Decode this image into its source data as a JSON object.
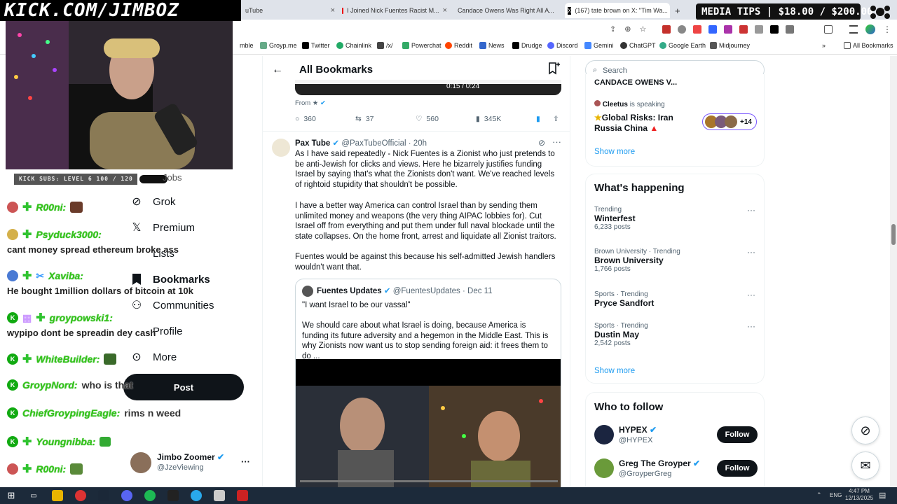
{
  "browser": {
    "tabs": [
      {
        "label": "uTube"
      },
      {
        "label": "I Joined Nick Fuentes Racist M..."
      },
      {
        "label": "Candace Owens Was Right All A..."
      },
      {
        "label": "(167) tate brown on X: \"Tim Wa..."
      }
    ],
    "new_tab": "+",
    "bookmarks": [
      "mble",
      "Groyp.me",
      "Twitter",
      "Chainlink",
      "/x/",
      "Powerchat",
      "Reddit",
      "News",
      "Drudge",
      "Discord",
      "Gemini",
      "ChatGPT",
      "Google Earth",
      "Midjourney"
    ],
    "all_bookmarks": "All Bookmarks",
    "more_bookmarks": "»"
  },
  "overlay": {
    "title": "KICK.COM/JIMBOZ",
    "media_tips": "MEDIA TIPS | $18.00 / $200.00",
    "kick_subs": "KICK SUBS: LEVEL 6 100 / 120",
    "chat": [
      {
        "name": "R00ni:",
        "message": "",
        "badge_color": "#2fc32f"
      },
      {
        "name": "Psyduck3000:",
        "message": "cant money spread ethereum broke ass",
        "badge_color": "#d4b04a"
      },
      {
        "name": "Xaviba:",
        "message": "He bought 1million dollars of bitcoin at 10k",
        "badge_color": "#4a7ad4"
      },
      {
        "name": "groypowski1:",
        "message": "wypipo dont be spreadin dey cash",
        "badge_color": "#2fc32f"
      },
      {
        "name": "WhiteBuilder:",
        "message": "",
        "badge_color": "#2fc32f"
      },
      {
        "name": "GroypNord:",
        "message": "who is that",
        "badge_color": "#2fc32f"
      },
      {
        "name": "ChiefGroypingEagle:",
        "message": "rims n weed",
        "badge_color": "#2fc32f"
      },
      {
        "name": "Youngnibba:",
        "message": "",
        "badge_color": "#2fc32f"
      },
      {
        "name": "R00ni:",
        "message": "",
        "badge_color": "#2fc32f"
      }
    ]
  },
  "x_nav": {
    "items": [
      "Grok",
      "Premium",
      "Lists",
      "Bookmarks",
      "Communities",
      "Profile",
      "More"
    ],
    "partial_item": "Jobs",
    "post_button": "Post",
    "account_name": "Jimbo Zoomer",
    "account_handle": "@JzeViewing",
    "more_icon": "···"
  },
  "header": {
    "title": "All Bookmarks",
    "back_icon": "←"
  },
  "video_top": {
    "time": "0:15 / 0:24",
    "from_label": "From",
    "replies": "360",
    "reposts": "37",
    "likes": "560",
    "views": "345K"
  },
  "tweet": {
    "author": "Pax Tube",
    "handle": "@PaxTubeOfficial",
    "time": "20h",
    "paragraph1": "As I have said repeatedly - Nick Fuentes is a Zionist who just pretends to be anti-Jewish for clicks and views. Here he bizarrely justifies funding Israel by saying that's what the Zionists don't want. We've reached levels of rightoid stupidity that shouldn't be possible.",
    "paragraph2": "I have a better way America can control Israel than by sending them unlimited money and weapons (the very thing AIPAC lobbies for). Cut Israel off from everything and put them under full naval blockade until the state collapses. On the home front, arrest and liquidate all Zionist traitors.",
    "paragraph3": "Fuentes would be against this because his self-admitted Jewish handlers wouldn't want that.",
    "quote": {
      "author": "Fuentes Updates",
      "handle": "@FuentesUpdates",
      "date": "Dec 11",
      "line1": "\"I want Israel to be our vassal\"",
      "line2": "We should care about what Israel is doing, because America is funding its future adversity and a hegemon in the Middle East. This is why Zionists now want us to stop sending foreign aid: it frees them to do ..."
    }
  },
  "right": {
    "search_placeholder": "Search",
    "space_top": "CANDACE OWENS V...",
    "space_host": "Cleetus",
    "space_status": "is speaking",
    "space_title": "Global Risks: Iran Russia China",
    "space_listeners": "+14",
    "show_more": "Show more",
    "whats_happening": "What's happening",
    "trends": [
      {
        "category": "Trending",
        "name": "Winterfest",
        "count": "6,233 posts"
      },
      {
        "category": "Brown University · Trending",
        "name": "Brown University",
        "count": "1,766 posts"
      },
      {
        "category": "Sports · Trending",
        "name": "Pryce Sandfort",
        "count": ""
      },
      {
        "category": "Sports · Trending",
        "name": "Dustin May",
        "count": "2,542 posts"
      }
    ],
    "who_to_follow": "Who to follow",
    "follow": [
      {
        "name": "HYPEX",
        "handle": "@HYPEX",
        "button": "Follow"
      },
      {
        "name": "Greg The Groyper",
        "handle": "@GroyperGreg",
        "button": "Follow"
      }
    ]
  },
  "taskbar": {
    "lang": "ENG",
    "time": "4:47 PM",
    "date": "12/13/2025"
  }
}
